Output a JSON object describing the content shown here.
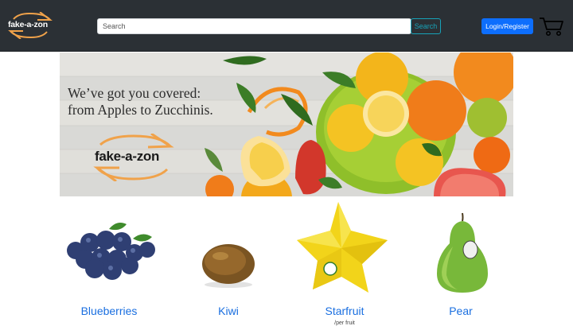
{
  "header": {
    "brand": "fake-a-zon",
    "search": {
      "placeholder": "Search",
      "value": ""
    },
    "search_button": "Search",
    "login_button": "Login/Register",
    "cart_icon": "shopping-cart-icon"
  },
  "hero": {
    "tagline_line1": "We’ve got you covered:",
    "tagline_line2": "from Apples to Zucchinis.",
    "brand": "fake-a-zon"
  },
  "products": [
    {
      "name": "Blueberries",
      "image": "blueberries",
      "sub": ""
    },
    {
      "name": "Kiwi",
      "image": "kiwi",
      "sub": ""
    },
    {
      "name": "Starfruit",
      "image": "starfruit",
      "sub": "/per fruit"
    },
    {
      "name": "Pear",
      "image": "pear",
      "sub": ""
    }
  ],
  "colors": {
    "navbar": "#2b3035",
    "accent_orange": "#f0a24a",
    "link_blue": "#1a6fe0",
    "login_blue": "#0d6efd",
    "search_teal": "#17a2b8"
  }
}
